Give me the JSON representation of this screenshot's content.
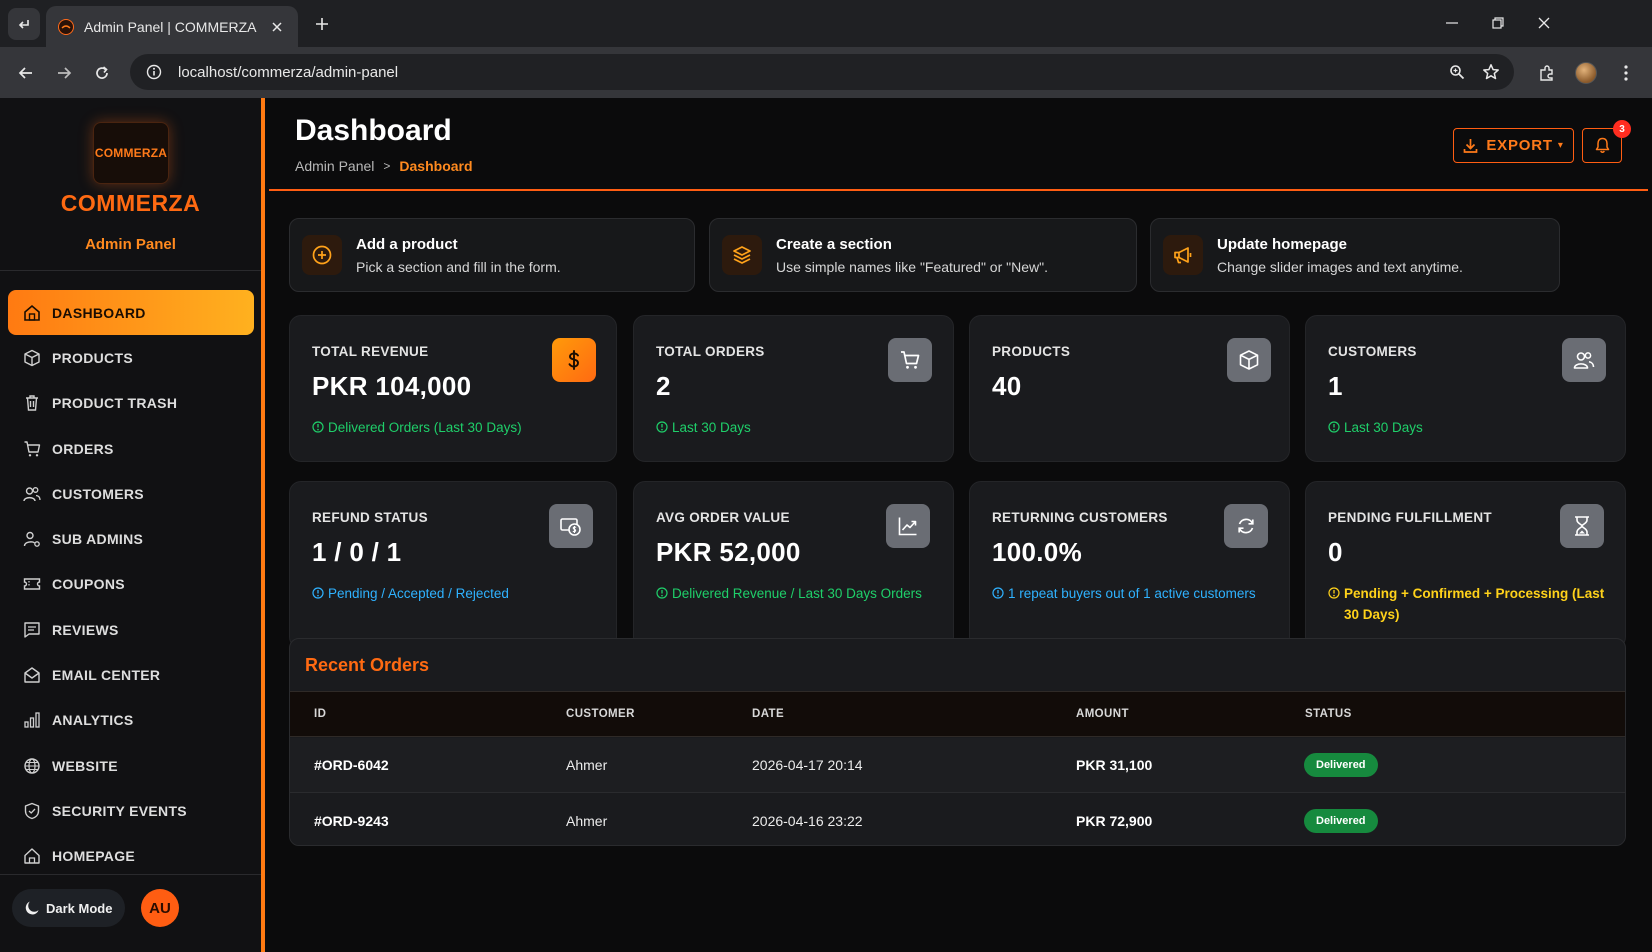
{
  "browser": {
    "tab_title": "Admin Panel | COMMERZA",
    "url": "localhost/commerza/admin-panel"
  },
  "sidebar": {
    "logo_text": "COMMERZA",
    "brand": "COMMERZA",
    "subtitle": "Admin Panel",
    "items": [
      {
        "label": "DASHBOARD",
        "icon": "dashboard-icon",
        "active": true
      },
      {
        "label": "PRODUCTS",
        "icon": "box-icon"
      },
      {
        "label": "PRODUCT TRASH",
        "icon": "trash-icon"
      },
      {
        "label": "ORDERS",
        "icon": "cart-icon"
      },
      {
        "label": "CUSTOMERS",
        "icon": "users-icon"
      },
      {
        "label": "SUB ADMINS",
        "icon": "user-gear-icon"
      },
      {
        "label": "COUPONS",
        "icon": "ticket-icon"
      },
      {
        "label": "REVIEWS",
        "icon": "review-icon"
      },
      {
        "label": "EMAIL CENTER",
        "icon": "envelope-icon"
      },
      {
        "label": "ANALYTICS",
        "icon": "bar-chart-icon"
      },
      {
        "label": "WEBSITE",
        "icon": "globe-icon"
      },
      {
        "label": "SECURITY EVENTS",
        "icon": "shield-icon"
      },
      {
        "label": "HOMEPAGE",
        "icon": "home-icon"
      }
    ],
    "dark_mode_label": "Dark Mode",
    "avatar_initials": "AU"
  },
  "header": {
    "title": "Dashboard",
    "breadcrumb_parent": "Admin Panel",
    "breadcrumb_sep": ">",
    "breadcrumb_current": "Dashboard",
    "export_label": "EXPORT",
    "notification_count": "3"
  },
  "tips": [
    {
      "title": "Add a product",
      "desc": "Pick a section and fill in the form.",
      "icon": "plus-circle-icon"
    },
    {
      "title": "Create a section",
      "desc": "Use simple names like \"Featured\" or \"New\".",
      "icon": "layers-icon"
    },
    {
      "title": "Update homepage",
      "desc": "Change slider images and text anytime.",
      "icon": "megaphone-icon"
    }
  ],
  "stats": [
    {
      "label": "TOTAL REVENUE",
      "value": "PKR 104,000",
      "note": "Delivered Orders (Last 30 Days)",
      "icon": "dollar-icon"
    },
    {
      "label": "TOTAL ORDERS",
      "value": "2",
      "note": "Last 30 Days",
      "icon": "cart-icon"
    },
    {
      "label": "PRODUCTS",
      "value": "40",
      "note": "",
      "icon": "box-icon"
    },
    {
      "label": "CUSTOMERS",
      "value": "1",
      "note": "Last 30 Days",
      "icon": "users-icon"
    },
    {
      "label": "REFUND STATUS",
      "value": "1 / 0 / 1",
      "note": "Pending / Accepted / Rejected",
      "icon": "refund-icon"
    },
    {
      "label": "AVG ORDER VALUE",
      "value": "PKR 52,000",
      "note": "Delivered Revenue / Last 30 Days Orders",
      "icon": "line-chart-icon"
    },
    {
      "label": "RETURNING CUSTOMERS",
      "value": "100.0%",
      "note": "1 repeat buyers out of 1 active customers",
      "icon": "refresh-icon"
    },
    {
      "label": "PENDING FULFILLMENT",
      "value": "0",
      "note": "Pending + Confirmed + Processing (Last 30 Days)",
      "icon": "hourglass-icon"
    }
  ],
  "recent_orders": {
    "title": "Recent Orders",
    "columns": [
      "ID",
      "CUSTOMER",
      "DATE",
      "AMOUNT",
      "STATUS"
    ],
    "rows": [
      {
        "id": "#ORD-6042",
        "customer": "Ahmer",
        "date": "2026-04-17 20:14",
        "amount": "PKR 31,100",
        "status": "Delivered"
      },
      {
        "id": "#ORD-9243",
        "customer": "Ahmer",
        "date": "2026-04-16 23:22",
        "amount": "PKR 72,900",
        "status": "Delivered"
      }
    ]
  },
  "colors": {
    "accent": "#ff6a12",
    "accent_gradient_end": "#ffb11f",
    "success": "#1fcf6a",
    "info": "#2fb2ff",
    "warning": "#ffd21a",
    "delivered_badge": "#168a3e"
  }
}
